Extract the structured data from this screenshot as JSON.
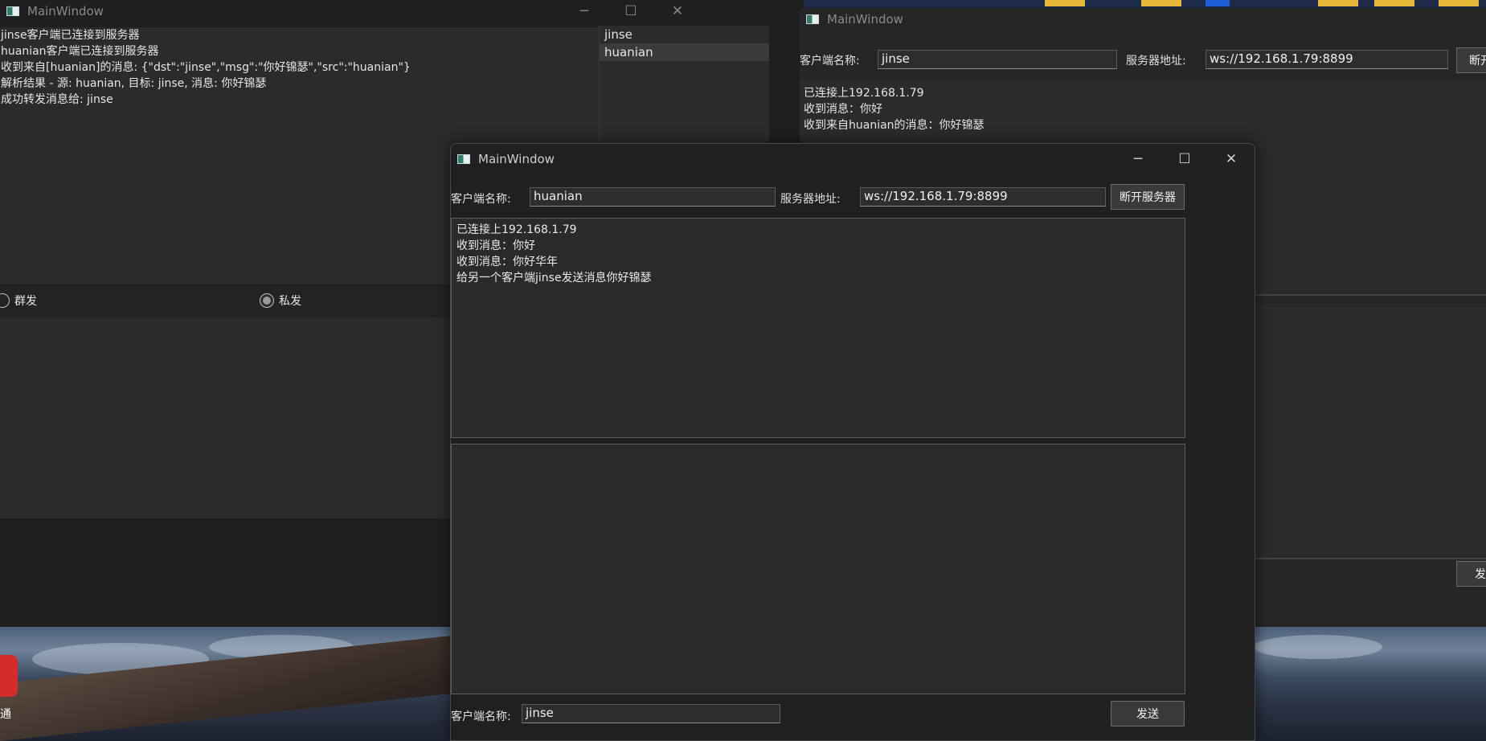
{
  "desktop": {
    "icon_label": "通",
    "strip_colors": [
      "#e6b93a",
      "#e6b93a",
      "#1f5fd6",
      "#e6b93a",
      "#e6b93a",
      "#e6b93a"
    ]
  },
  "server_window": {
    "title": "MainWindow",
    "log": [
      "jinse客户端已连接到服务器",
      "huanian客户端已连接到服务器",
      "收到来自[huanian]的消息: {\"dst\":\"jinse\",\"msg\":\"你好锦瑟\",\"src\":\"huanian\"}",
      "解析结果 - 源: huanian, 目标: jinse, 消息: 你好锦瑟",
      "成功转发消息给: jinse"
    ],
    "users": [
      "jinse",
      "huanian"
    ],
    "radio_broadcast": "群发",
    "radio_private": "私发"
  },
  "jinse_window": {
    "title": "MainWindow",
    "client_name_label": "客户端名称:",
    "client_name_value": "jinse",
    "server_addr_label": "服务器地址:",
    "server_addr_value": "ws://192.168.1.79:8899",
    "disconnect_button": "断开",
    "send_button": "发",
    "messages": [
      "已连接上192.168.1.79",
      "收到消息：你好",
      "收到来自huanian的消息：你好锦瑟"
    ]
  },
  "huanian_window": {
    "title": "MainWindow",
    "client_name_label": "客户端名称:",
    "client_name_value": "huanian",
    "server_addr_label": "服务器地址:",
    "server_addr_value": "ws://192.168.1.79:8899",
    "disconnect_button": "断开服务器",
    "messages": [
      "已连接上192.168.1.79",
      "收到消息：你好",
      "收到消息：你好华年",
      "给另一个客户端jinse发送消息你好锦瑟"
    ],
    "compose_text": "",
    "target_label": "客户端名称:",
    "target_value": "jinse",
    "send_button": "发送"
  }
}
